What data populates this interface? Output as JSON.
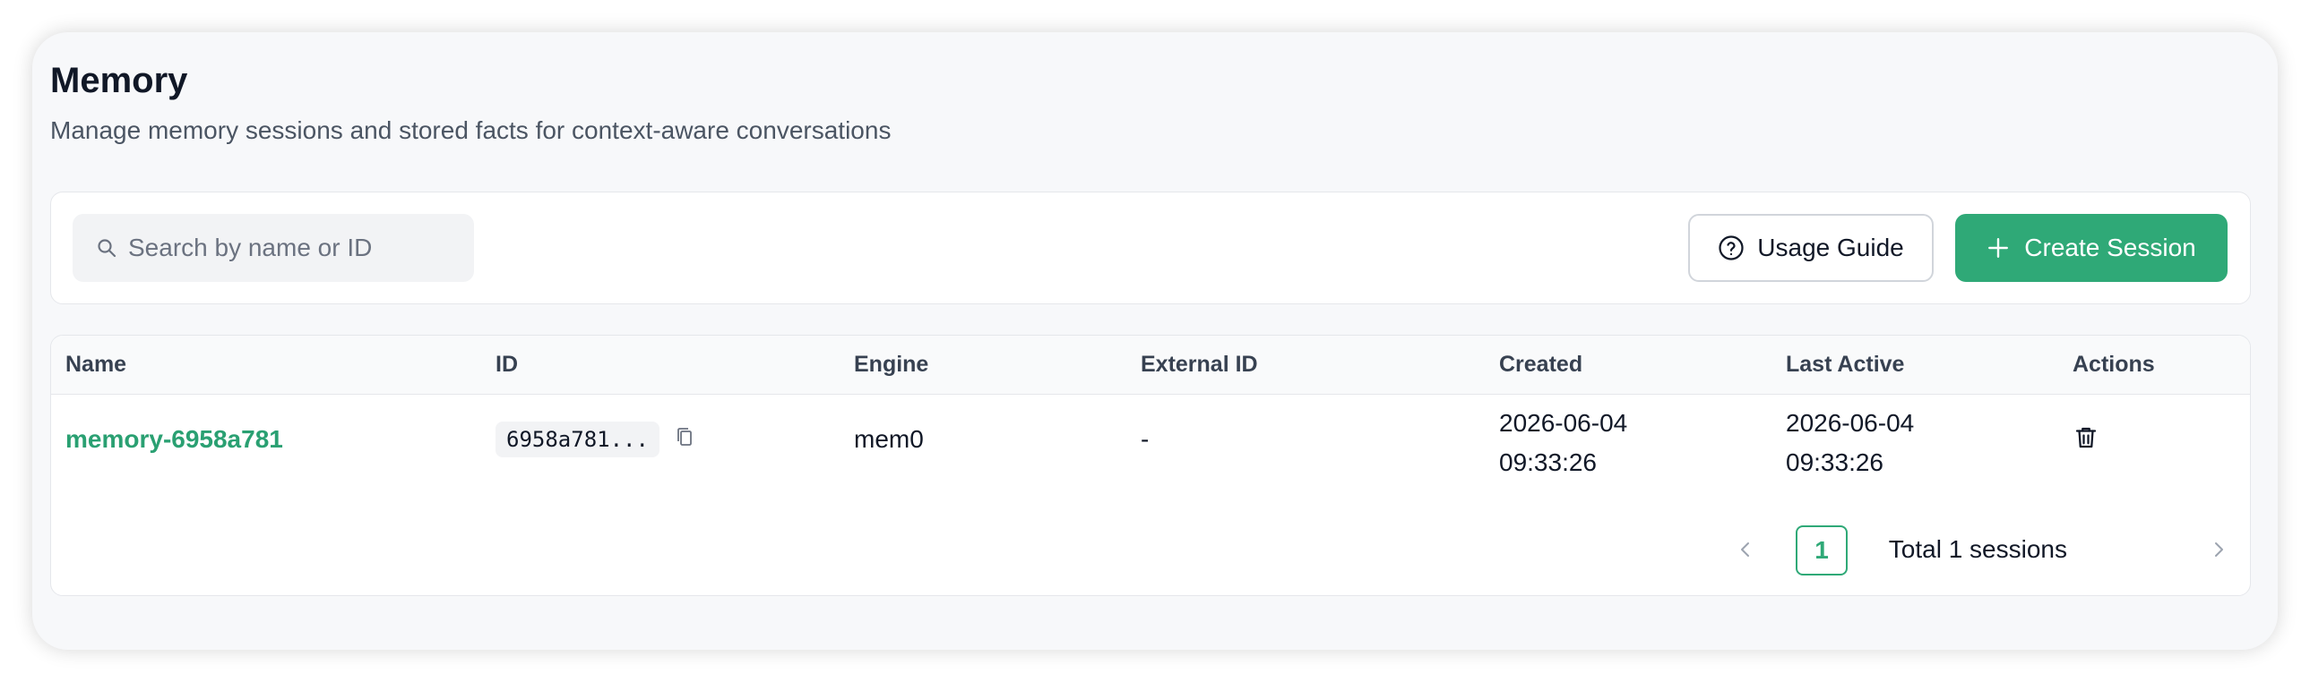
{
  "header": {
    "title": "Memory",
    "subtitle": "Manage memory sessions and stored facts for context-aware conversations"
  },
  "toolbar": {
    "search_placeholder": "Search by name or ID",
    "search_value": "",
    "usage_guide_label": "Usage Guide",
    "create_session_label": "Create Session"
  },
  "table": {
    "columns": {
      "name": "Name",
      "id": "ID",
      "engine": "Engine",
      "external_id": "External ID",
      "created": "Created",
      "last_active": "Last Active",
      "actions": "Actions"
    },
    "rows": [
      {
        "name": "memory-6958a781",
        "id": "6958a781...",
        "engine": "mem0",
        "external_id": "-",
        "created_date": "2026-06-04",
        "created_time": "09:33:26",
        "last_active_date": "2026-06-04",
        "last_active_time": "09:33:26"
      }
    ]
  },
  "pagination": {
    "total_label": "Total 1 sessions",
    "current_page": "1"
  },
  "colors": {
    "accent": "#2fa977",
    "link": "#2aa072",
    "background": "#f7f8fa"
  },
  "icons": {
    "search": "search-icon",
    "help": "help-circle-icon",
    "plus": "plus-icon",
    "copy": "copy-icon",
    "delete": "trash-icon",
    "prev": "chevron-left-icon",
    "next": "chevron-right-icon"
  }
}
